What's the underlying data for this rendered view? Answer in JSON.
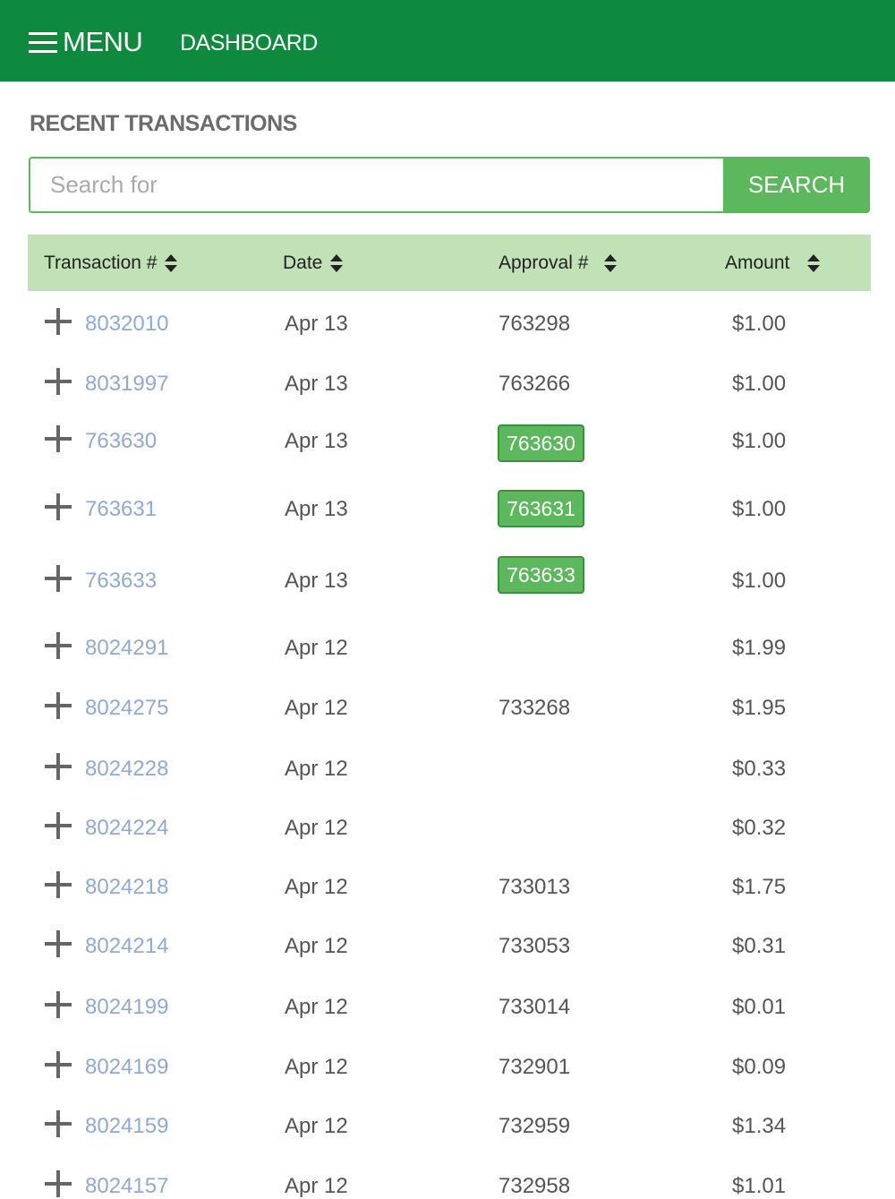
{
  "nav": {
    "menu_label": "MENU",
    "dashboard_label": "DASHBOARD"
  },
  "section_title": "RECENT TRANSACTIONS",
  "search": {
    "placeholder": "Search for",
    "button_label": "SEARCH"
  },
  "table": {
    "columns": [
      "Transaction #",
      "Date",
      "Approval #",
      "Amount"
    ],
    "rows": [
      {
        "txn": "8032010",
        "date": "Apr 13",
        "approval": "763298",
        "approval_highlight": false,
        "amount": "$1.00"
      },
      {
        "txn": "8031997",
        "date": "Apr 13",
        "approval": "763266",
        "approval_highlight": false,
        "amount": "$1.00"
      },
      {
        "txn": "763630",
        "date": "Apr 13",
        "approval": "763630",
        "approval_highlight": true,
        "amount": "$1.00"
      },
      {
        "txn": "763631",
        "date": "Apr 13",
        "approval": "763631",
        "approval_highlight": true,
        "amount": "$1.00"
      },
      {
        "txn": "763633",
        "date": "Apr 13",
        "approval": "763633",
        "approval_highlight": true,
        "amount": "$1.00"
      },
      {
        "txn": "8024291",
        "date": "Apr 12",
        "approval": "",
        "approval_highlight": false,
        "amount": "$1.99"
      },
      {
        "txn": "8024275",
        "date": "Apr 12",
        "approval": "733268",
        "approval_highlight": false,
        "amount": "$1.95"
      },
      {
        "txn": "8024228",
        "date": "Apr 12",
        "approval": "",
        "approval_highlight": false,
        "amount": "$0.33"
      },
      {
        "txn": "8024224",
        "date": "Apr 12",
        "approval": "",
        "approval_highlight": false,
        "amount": "$0.32"
      },
      {
        "txn": "8024218",
        "date": "Apr 12",
        "approval": "733013",
        "approval_highlight": false,
        "amount": "$1.75"
      },
      {
        "txn": "8024214",
        "date": "Apr 12",
        "approval": "733053",
        "approval_highlight": false,
        "amount": "$0.31"
      },
      {
        "txn": "8024199",
        "date": "Apr 12",
        "approval": "733014",
        "approval_highlight": false,
        "amount": "$0.01"
      },
      {
        "txn": "8024169",
        "date": "Apr 12",
        "approval": "732901",
        "approval_highlight": false,
        "amount": "$0.09"
      },
      {
        "txn": "8024159",
        "date": "Apr 12",
        "approval": "732959",
        "approval_highlight": false,
        "amount": "$1.34"
      },
      {
        "txn": "8024157",
        "date": "Apr 12",
        "approval": "732958",
        "approval_highlight": false,
        "amount": "$1.01"
      }
    ]
  },
  "colors": {
    "header_green": "#0e8a3e",
    "accent_green": "#5cb85c",
    "table_header_bg": "#c1e2b6",
    "link_blue": "#8faad6"
  },
  "icons": {
    "menu": "hamburger-icon",
    "sort": "sort-icon",
    "expand": "plus-icon"
  }
}
